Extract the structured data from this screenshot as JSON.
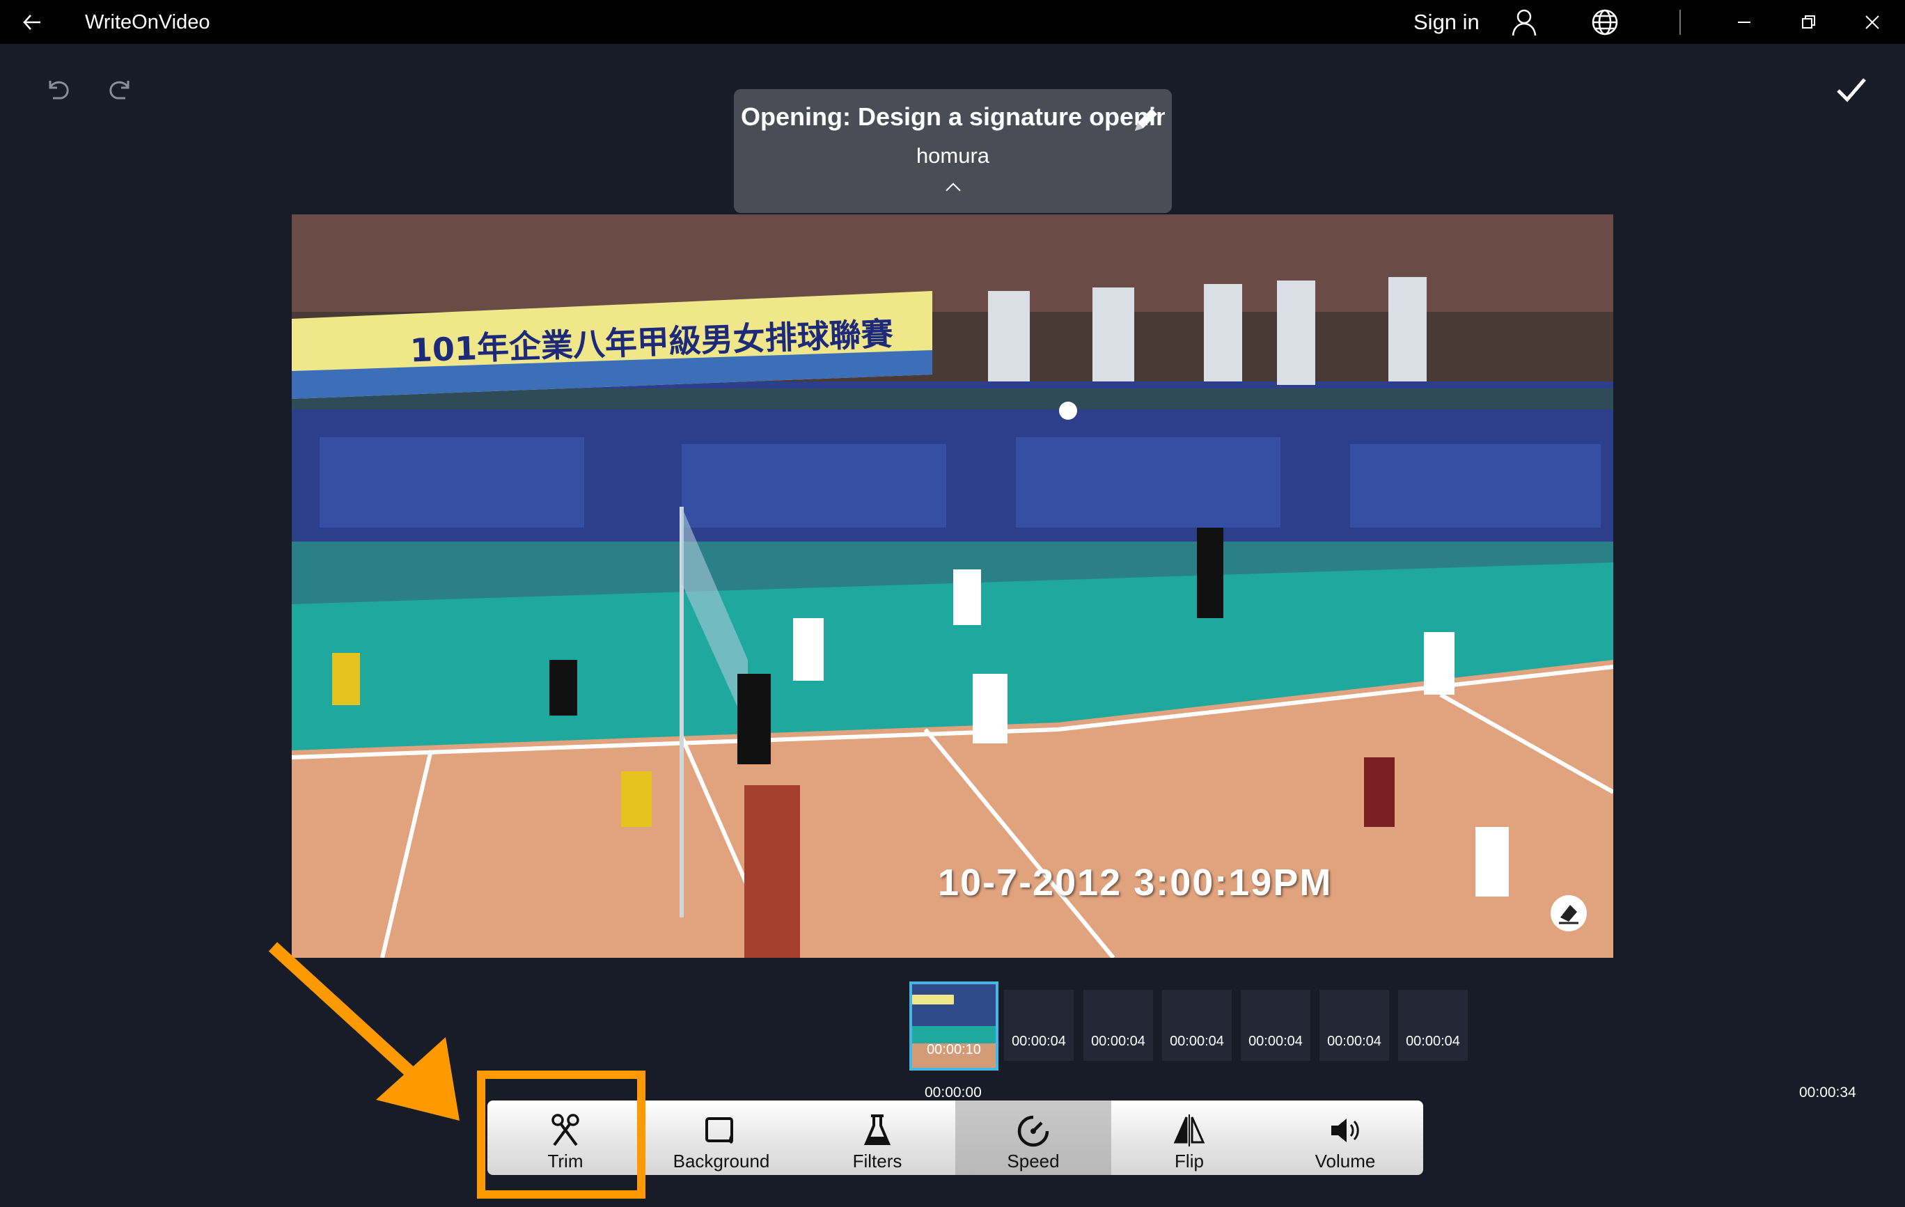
{
  "app": {
    "title": "WriteOnVideo"
  },
  "titlebar": {
    "back_icon": "back-arrow-icon",
    "sign_in": "Sign in",
    "user_icon": "user-icon",
    "language_icon": "globe-icon"
  },
  "opening": {
    "title": "Opening: Design a signature opening",
    "subtitle": "homura"
  },
  "video": {
    "overlay_timestamp": "10-7-2012  3:00:19PM",
    "banner_text": "101年企業八年甲級男女排球聯賽"
  },
  "timeline": {
    "clips": [
      {
        "duration": "00:00:10",
        "selected": true
      },
      {
        "duration": "00:00:04"
      },
      {
        "duration": "00:00:04"
      },
      {
        "duration": "00:00:04"
      },
      {
        "duration": "00:00:04"
      },
      {
        "duration": "00:00:04"
      },
      {
        "duration": "00:00:04"
      }
    ],
    "start_time": "00:00:00",
    "end_time": "00:00:34"
  },
  "tools": [
    {
      "label": "Trim",
      "icon": "scissors-icon"
    },
    {
      "label": "Background",
      "icon": "background-fill-icon"
    },
    {
      "label": "Filters",
      "icon": "flask-icon"
    },
    {
      "label": "Speed",
      "icon": "speedometer-icon",
      "active": true
    },
    {
      "label": "Flip",
      "icon": "flip-icon"
    },
    {
      "label": "Volume",
      "icon": "speaker-icon"
    }
  ],
  "colors": {
    "background": "#181c27",
    "titlebar": "#000000",
    "highlight": "#ff9900",
    "selected_clip_border": "#47b5e6"
  }
}
